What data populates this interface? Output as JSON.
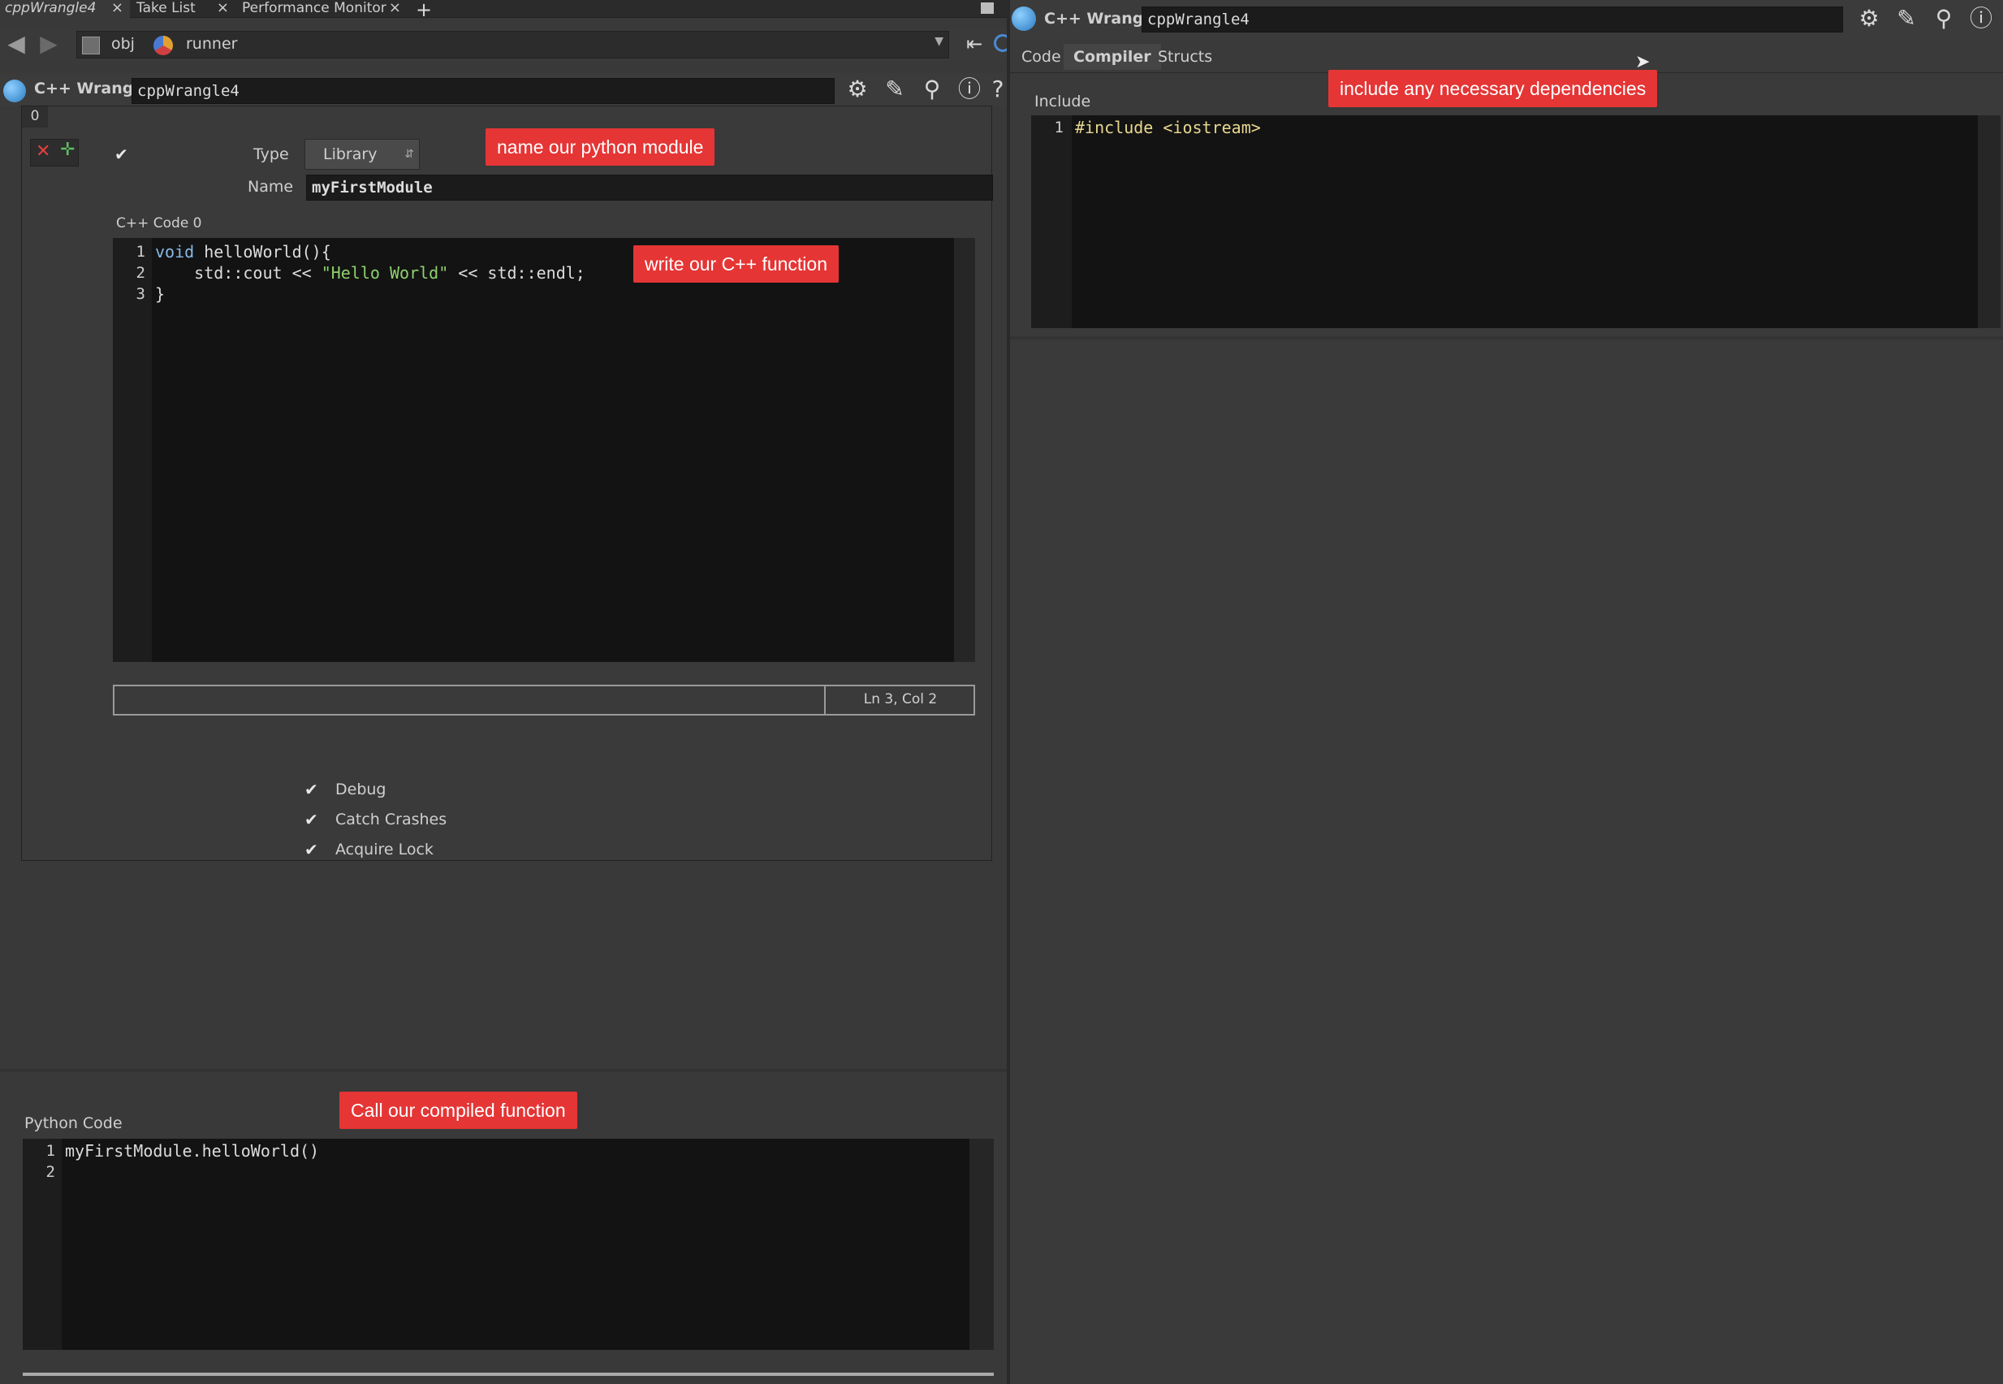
{
  "tabs": [
    {
      "label": "cppWrangle4",
      "close": "×"
    },
    {
      "label": "Take List",
      "close": "×"
    },
    {
      "label": "Performance Monitor",
      "close": "×"
    }
  ],
  "tab_add": "+",
  "path": {
    "root": "obj",
    "node": "runner"
  },
  "left_node": {
    "type_label": "C++ Wrangle",
    "name": "cppWrangle4"
  },
  "right_node": {
    "type_label": "C++ Wrangle",
    "name": "cppWrangle4"
  },
  "multiparm_index": "0",
  "module": {
    "type_label": "Type",
    "type_value": "Library",
    "name_label": "Name",
    "name_value": "myFirstModule",
    "code_label": "C++ Code 0",
    "code_lines": [
      "1",
      "2",
      "3"
    ],
    "code": {
      "kw": "void",
      "fn": " helloWorld(){",
      "line2a": "    std::cout << ",
      "str": "\"Hello World\"",
      "line2b": " << std::endl;",
      "line3": "}"
    },
    "status": "Ln 3, Col 2"
  },
  "options": [
    {
      "label": "Debug"
    },
    {
      "label": "Catch Crashes"
    },
    {
      "label": "Acquire Lock"
    }
  ],
  "python": {
    "label": "Python Code",
    "line_numbers": [
      "1",
      "2"
    ],
    "code": "myFirstModule.helloWorld()"
  },
  "right_tabs": [
    "Code",
    "Compiler",
    "Structs"
  ],
  "include": {
    "label": "Include",
    "line": "1",
    "code": "#include <iostream>"
  },
  "callouts": {
    "module": "name our python module",
    "function": "write our C++ function",
    "deps": "include any necessary dependencies",
    "call": "Call our compiled function"
  },
  "icons": [
    "gear-icon",
    "brush-icon",
    "search-icon",
    "info-icon",
    "back-arrow-icon",
    "forward-arrow-icon",
    "pin-icon"
  ],
  "colors": {
    "callout": "#e53535",
    "editor_bg": "#131313",
    "panel_bg": "#393939",
    "string": "#8fd16e"
  }
}
